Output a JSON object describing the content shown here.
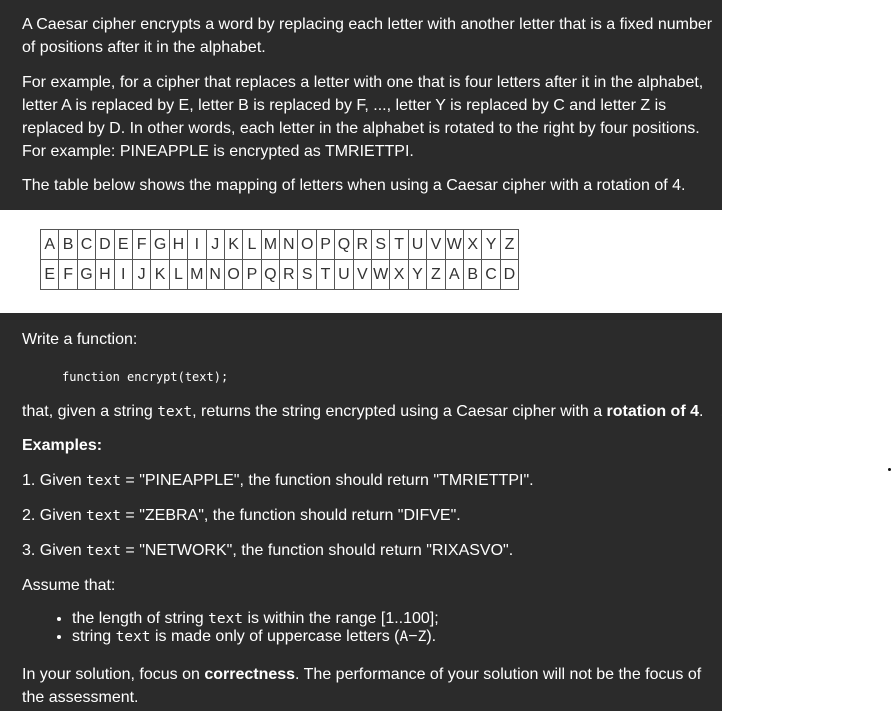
{
  "intro": {
    "p1": "A Caesar cipher encrypts a word by replacing each letter with another letter that is a fixed number of positions after it in the alphabet.",
    "p2": "For example, for a cipher that replaces a letter with one that is four letters after it in the alphabet, letter A is replaced by E, letter B is replaced by F, ..., letter Y is replaced by C and letter Z is replaced by D. In other words, each letter in the alphabet is rotated to the right by four positions. For example: PINEAPPLE is encrypted as TMRIETTPI.",
    "p3": "The table below shows the mapping of letters when using a Caesar cipher with a rotation of 4."
  },
  "mapping": {
    "plain": [
      "A",
      "B",
      "C",
      "D",
      "E",
      "F",
      "G",
      "H",
      "I",
      "J",
      "K",
      "L",
      "M",
      "N",
      "O",
      "P",
      "Q",
      "R",
      "S",
      "T",
      "U",
      "V",
      "W",
      "X",
      "Y",
      "Z"
    ],
    "cipher": [
      "E",
      "F",
      "G",
      "H",
      "I",
      "J",
      "K",
      "L",
      "M",
      "N",
      "O",
      "P",
      "Q",
      "R",
      "S",
      "T",
      "U",
      "V",
      "W",
      "X",
      "Y",
      "Z",
      "A",
      "B",
      "C",
      "D"
    ]
  },
  "task": {
    "write": "Write a function:",
    "signature": "function encrypt(text);",
    "desc_pre": "that, given a string ",
    "desc_code": "text",
    "desc_mid": ", returns the string encrypted using a Caesar cipher with a ",
    "desc_bold": "rotation of 4",
    "desc_end": "."
  },
  "examples": {
    "heading": "Examples:",
    "items": [
      {
        "pre": "1. Given ",
        "code": "text",
        "post": " = \"PINEAPPLE\", the function should return \"TMRIETTPI\"."
      },
      {
        "pre": "2. Given ",
        "code": "text",
        "post": " = \"ZEBRA\", the function should return \"DIFVE\"."
      },
      {
        "pre": "3. Given ",
        "code": "text",
        "post": " = \"NETWORK\", the function should return \"RIXASVO\"."
      }
    ]
  },
  "assume": {
    "heading": "Assume that:",
    "b1_pre": "the length of string ",
    "b1_code": "text",
    "b1_post": " is within the range [1..100];",
    "b2_pre": "string ",
    "b2_code": "text",
    "b2_mid": " is made only of uppercase letters (",
    "b2_code2": "A",
    "b2_dash": "−",
    "b2_code3": "Z",
    "b2_end": ")."
  },
  "focus": {
    "pre": "In your solution, focus on ",
    "bold": "correctness",
    "post": ". The performance of your solution will not be the focus of the assessment."
  }
}
